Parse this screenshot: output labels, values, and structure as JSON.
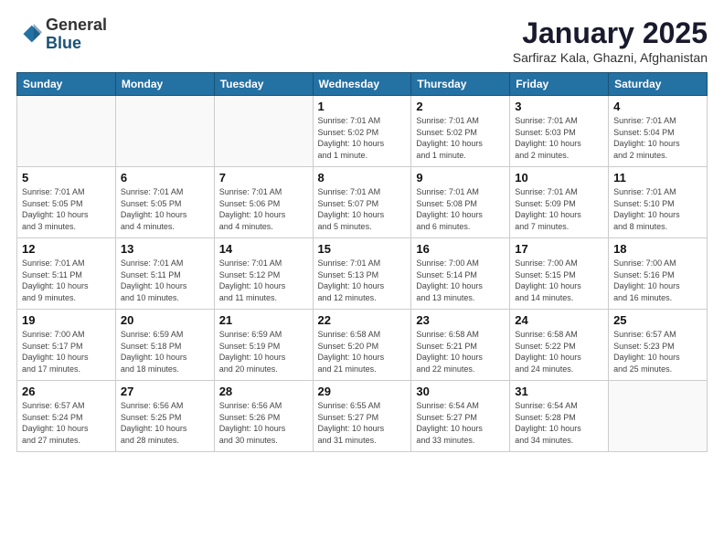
{
  "header": {
    "logo": {
      "line1": "General",
      "line2": "Blue"
    },
    "title": "January 2025",
    "subtitle": "Sarfiraz Kala, Ghazni, Afghanistan"
  },
  "weekdays": [
    "Sunday",
    "Monday",
    "Tuesday",
    "Wednesday",
    "Thursday",
    "Friday",
    "Saturday"
  ],
  "weeks": [
    [
      {
        "day": "",
        "info": ""
      },
      {
        "day": "",
        "info": ""
      },
      {
        "day": "",
        "info": ""
      },
      {
        "day": "1",
        "info": "Sunrise: 7:01 AM\nSunset: 5:02 PM\nDaylight: 10 hours\nand 1 minute."
      },
      {
        "day": "2",
        "info": "Sunrise: 7:01 AM\nSunset: 5:02 PM\nDaylight: 10 hours\nand 1 minute."
      },
      {
        "day": "3",
        "info": "Sunrise: 7:01 AM\nSunset: 5:03 PM\nDaylight: 10 hours\nand 2 minutes."
      },
      {
        "day": "4",
        "info": "Sunrise: 7:01 AM\nSunset: 5:04 PM\nDaylight: 10 hours\nand 2 minutes."
      }
    ],
    [
      {
        "day": "5",
        "info": "Sunrise: 7:01 AM\nSunset: 5:05 PM\nDaylight: 10 hours\nand 3 minutes."
      },
      {
        "day": "6",
        "info": "Sunrise: 7:01 AM\nSunset: 5:05 PM\nDaylight: 10 hours\nand 4 minutes."
      },
      {
        "day": "7",
        "info": "Sunrise: 7:01 AM\nSunset: 5:06 PM\nDaylight: 10 hours\nand 4 minutes."
      },
      {
        "day": "8",
        "info": "Sunrise: 7:01 AM\nSunset: 5:07 PM\nDaylight: 10 hours\nand 5 minutes."
      },
      {
        "day": "9",
        "info": "Sunrise: 7:01 AM\nSunset: 5:08 PM\nDaylight: 10 hours\nand 6 minutes."
      },
      {
        "day": "10",
        "info": "Sunrise: 7:01 AM\nSunset: 5:09 PM\nDaylight: 10 hours\nand 7 minutes."
      },
      {
        "day": "11",
        "info": "Sunrise: 7:01 AM\nSunset: 5:10 PM\nDaylight: 10 hours\nand 8 minutes."
      }
    ],
    [
      {
        "day": "12",
        "info": "Sunrise: 7:01 AM\nSunset: 5:11 PM\nDaylight: 10 hours\nand 9 minutes."
      },
      {
        "day": "13",
        "info": "Sunrise: 7:01 AM\nSunset: 5:11 PM\nDaylight: 10 hours\nand 10 minutes."
      },
      {
        "day": "14",
        "info": "Sunrise: 7:01 AM\nSunset: 5:12 PM\nDaylight: 10 hours\nand 11 minutes."
      },
      {
        "day": "15",
        "info": "Sunrise: 7:01 AM\nSunset: 5:13 PM\nDaylight: 10 hours\nand 12 minutes."
      },
      {
        "day": "16",
        "info": "Sunrise: 7:00 AM\nSunset: 5:14 PM\nDaylight: 10 hours\nand 13 minutes."
      },
      {
        "day": "17",
        "info": "Sunrise: 7:00 AM\nSunset: 5:15 PM\nDaylight: 10 hours\nand 14 minutes."
      },
      {
        "day": "18",
        "info": "Sunrise: 7:00 AM\nSunset: 5:16 PM\nDaylight: 10 hours\nand 16 minutes."
      }
    ],
    [
      {
        "day": "19",
        "info": "Sunrise: 7:00 AM\nSunset: 5:17 PM\nDaylight: 10 hours\nand 17 minutes."
      },
      {
        "day": "20",
        "info": "Sunrise: 6:59 AM\nSunset: 5:18 PM\nDaylight: 10 hours\nand 18 minutes."
      },
      {
        "day": "21",
        "info": "Sunrise: 6:59 AM\nSunset: 5:19 PM\nDaylight: 10 hours\nand 20 minutes."
      },
      {
        "day": "22",
        "info": "Sunrise: 6:58 AM\nSunset: 5:20 PM\nDaylight: 10 hours\nand 21 minutes."
      },
      {
        "day": "23",
        "info": "Sunrise: 6:58 AM\nSunset: 5:21 PM\nDaylight: 10 hours\nand 22 minutes."
      },
      {
        "day": "24",
        "info": "Sunrise: 6:58 AM\nSunset: 5:22 PM\nDaylight: 10 hours\nand 24 minutes."
      },
      {
        "day": "25",
        "info": "Sunrise: 6:57 AM\nSunset: 5:23 PM\nDaylight: 10 hours\nand 25 minutes."
      }
    ],
    [
      {
        "day": "26",
        "info": "Sunrise: 6:57 AM\nSunset: 5:24 PM\nDaylight: 10 hours\nand 27 minutes."
      },
      {
        "day": "27",
        "info": "Sunrise: 6:56 AM\nSunset: 5:25 PM\nDaylight: 10 hours\nand 28 minutes."
      },
      {
        "day": "28",
        "info": "Sunrise: 6:56 AM\nSunset: 5:26 PM\nDaylight: 10 hours\nand 30 minutes."
      },
      {
        "day": "29",
        "info": "Sunrise: 6:55 AM\nSunset: 5:27 PM\nDaylight: 10 hours\nand 31 minutes."
      },
      {
        "day": "30",
        "info": "Sunrise: 6:54 AM\nSunset: 5:27 PM\nDaylight: 10 hours\nand 33 minutes."
      },
      {
        "day": "31",
        "info": "Sunrise: 6:54 AM\nSunset: 5:28 PM\nDaylight: 10 hours\nand 34 minutes."
      },
      {
        "day": "",
        "info": ""
      }
    ]
  ]
}
